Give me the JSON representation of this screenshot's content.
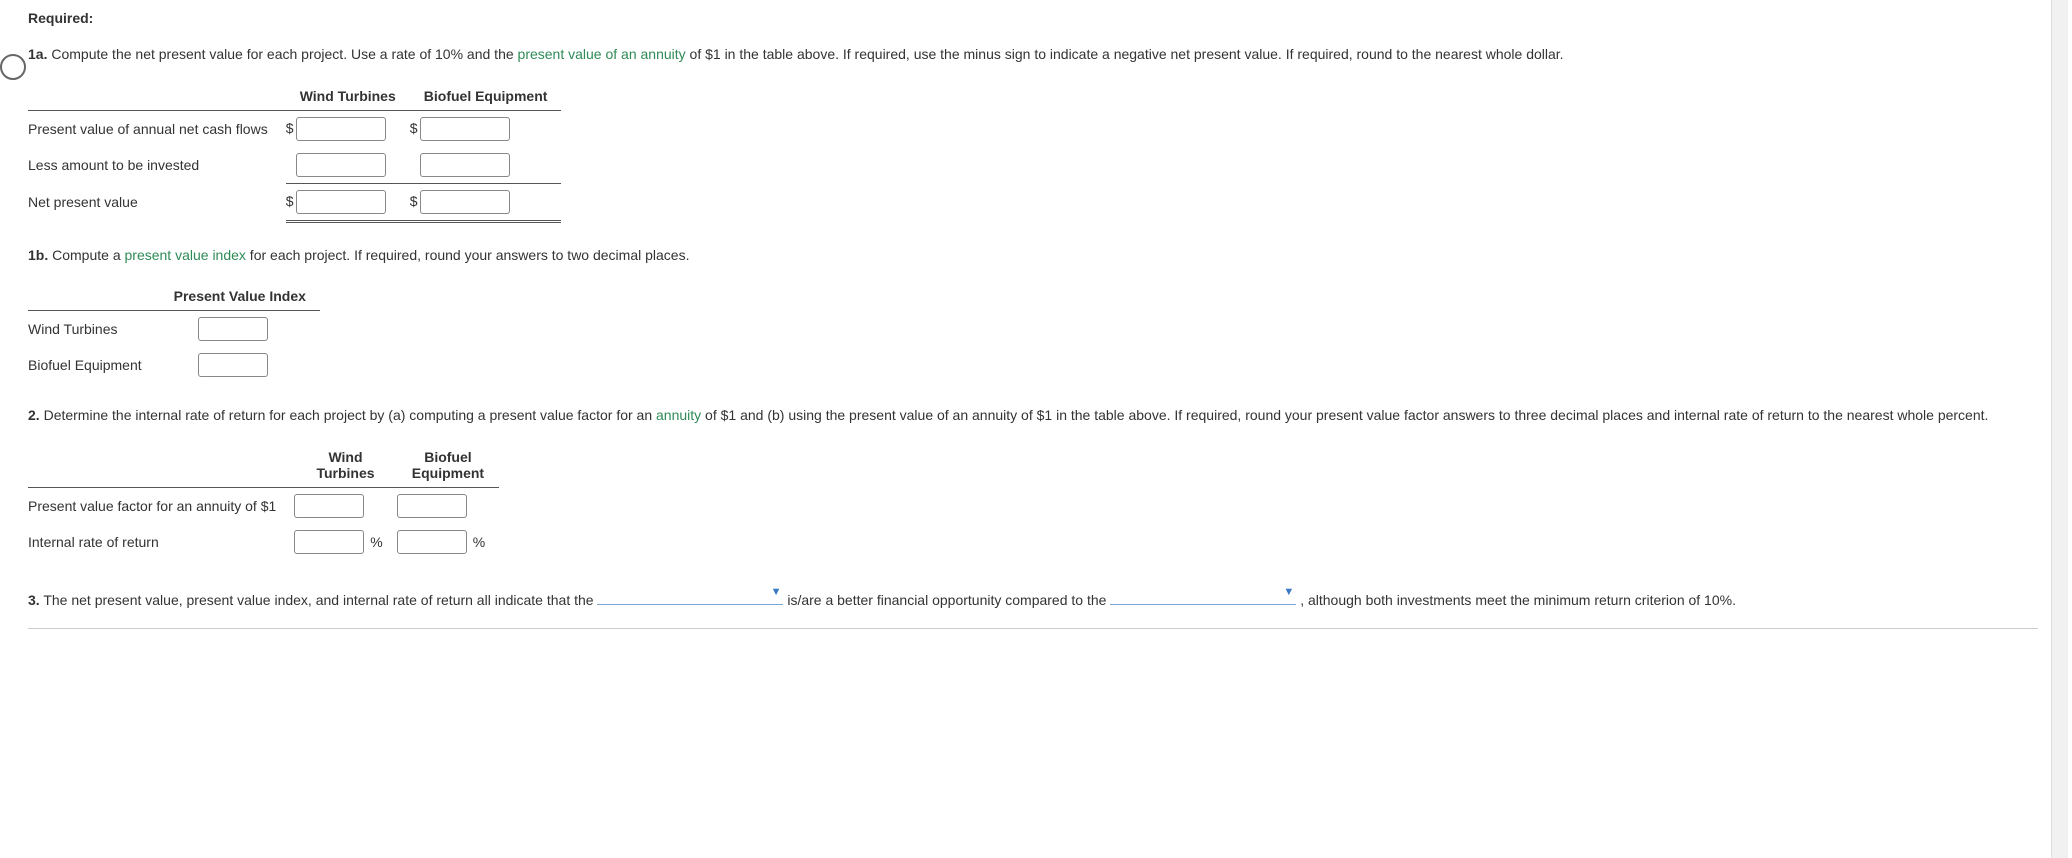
{
  "heading": "Required:",
  "q1a": {
    "num": "1a.",
    "text_before_link": " Compute the net present value for each project. Use a rate of 10% and the ",
    "link": "present value of an annuity",
    "text_after_link": " of $1 in the table above. If required, use the minus sign to indicate a negative net present value. If required, round to the nearest whole dollar."
  },
  "table1a": {
    "col1": "Wind Turbines",
    "col2": "Biofuel Equipment",
    "row1": "Present value of annual net cash flows",
    "row2": "Less amount to be invested",
    "row3": "Net present value",
    "currency": "$"
  },
  "q1b": {
    "num": "1b.",
    "text_before_link": " Compute a ",
    "link": "present value index",
    "text_after_link": " for each project. If required, round your answers to two decimal places."
  },
  "table1b": {
    "col1": "Present Value Index",
    "row1": "Wind Turbines",
    "row2": "Biofuel Equipment"
  },
  "q2": {
    "num": "2.",
    "text_before_link": " Determine the internal rate of return for each project by (a) computing a present value factor for an ",
    "link": "annuity",
    "text_after_link": " of $1 and (b) using the present value of an annuity of $1 in the table above. If required, round your present value factor answers to three decimal places and internal rate of return to the nearest whole percent."
  },
  "table2": {
    "col1_a": "Wind",
    "col1_b": "Turbines",
    "col2_a": "Biofuel",
    "col2_b": "Equipment",
    "row1": "Present value factor for an annuity of $1",
    "row2": "Internal rate of return",
    "pct": "%"
  },
  "q3": {
    "num": "3.",
    "t1": " The net present value, present value index, and internal rate of return all indicate that the ",
    "t2": " is/are a better financial opportunity compared to the ",
    "t3": ", although both investments meet the minimum return criterion of 10%."
  }
}
